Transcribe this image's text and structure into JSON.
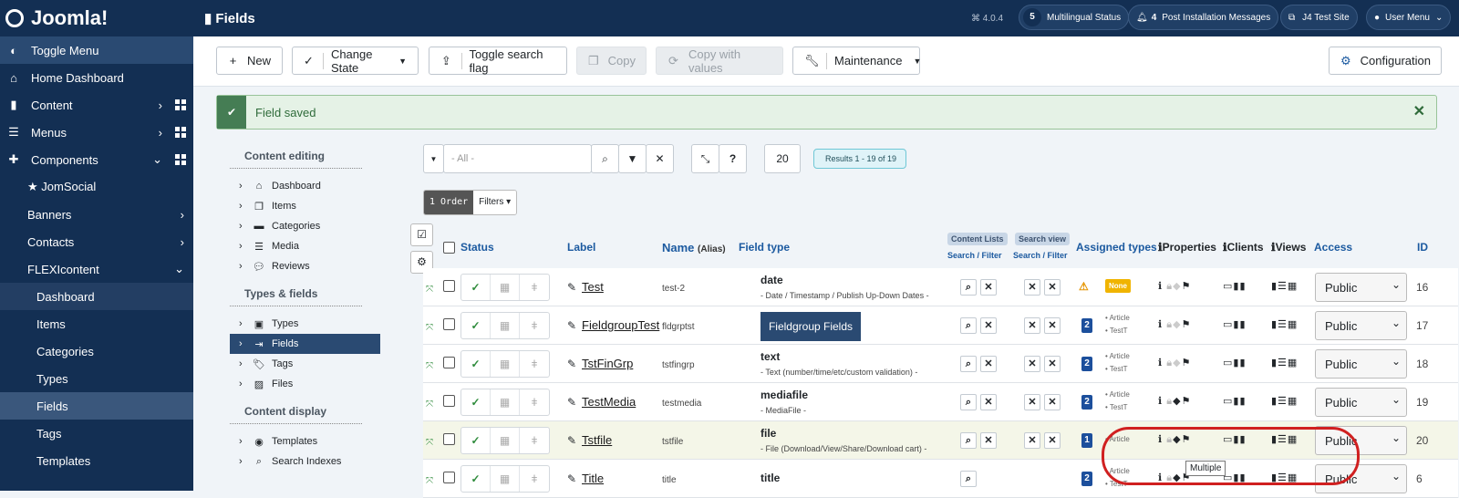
{
  "app": {
    "logo": "Joomla!",
    "version": "4.0.4"
  },
  "header": {
    "title": "Fields",
    "multilingual_count": "5",
    "multilingual": "Multilingual Status",
    "post_count": "4",
    "post": "Post Installation Messages",
    "site": "J4 Test Site",
    "user": "User Menu"
  },
  "sidebar": {
    "items": [
      {
        "label": "Toggle Menu",
        "icon": "toggle-icon"
      },
      {
        "label": "Home Dashboard",
        "icon": "home-icon"
      },
      {
        "label": "Content",
        "icon": "file-icon"
      },
      {
        "label": "Menus",
        "icon": "list-icon"
      },
      {
        "label": "Components",
        "icon": "puzzle-icon"
      },
      {
        "label": "★ JomSocial"
      },
      {
        "label": "Banners"
      },
      {
        "label": "Contacts"
      },
      {
        "label": "FLEXIcontent"
      },
      {
        "label": "Dashboard"
      },
      {
        "label": "Items"
      },
      {
        "label": "Categories"
      },
      {
        "label": "Types"
      },
      {
        "label": "Fields"
      },
      {
        "label": "Tags"
      },
      {
        "label": "Templates"
      }
    ]
  },
  "toolbar": {
    "new": "New",
    "change_state": "Change State",
    "toggle_search": "Toggle search flag",
    "copy": "Copy",
    "copy_values": "Copy with values",
    "maintenance": "Maintenance",
    "configuration": "Configuration"
  },
  "alert": {
    "message": "Field saved"
  },
  "leftmenu": {
    "section1": "Content editing",
    "s1": [
      "Dashboard",
      "Items",
      "Categories",
      "Media",
      "Reviews"
    ],
    "section2": "Types & fields",
    "s2": [
      "Types",
      "Fields",
      "Tags",
      "Files"
    ],
    "section3": "Content display",
    "s3": [
      "Templates",
      "Search Indexes"
    ]
  },
  "filters": {
    "select": "- All -",
    "limit": "20",
    "results": "Results 1 - 19 of 19",
    "order": "1 Order",
    "filters": "Filters"
  },
  "table": {
    "headers": {
      "status": "Status",
      "label": "Label",
      "name": "Name",
      "alias": "(Alias)",
      "field_type": "Field type",
      "content_lists": "Content Lists",
      "search_view": "Search view",
      "search_filter": "Search / Filter",
      "assigned": "Assigned types",
      "properties": "Properties",
      "clients": "Clients",
      "views": "Views",
      "access": "Access",
      "id": "ID"
    },
    "rows": [
      {
        "label": "Test",
        "name": "test-2",
        "type": "date",
        "desc": "- Date / Timestamp / Publish Up-Down Dates -",
        "assigned": "None",
        "types": [],
        "access": "Public",
        "id": "16"
      },
      {
        "label": "FieldgroupTest",
        "name": "fldgrptst",
        "type": "Fieldgroup Fields",
        "desc": "",
        "assigned": "2",
        "types": [
          "Article",
          "TestT"
        ],
        "access": "Public",
        "id": "17"
      },
      {
        "label": "TstFinGrp",
        "name": "tstfingrp",
        "type": "text",
        "desc": "- Text (number/time/etc/custom validation) -",
        "assigned": "2",
        "types": [
          "Article",
          "TestT"
        ],
        "access": "Public",
        "id": "18"
      },
      {
        "label": "TestMedia",
        "name": "testmedia",
        "type": "mediafile",
        "desc": "- MediaFile -",
        "assigned": "2",
        "types": [
          "Article",
          "TestT"
        ],
        "access": "Public",
        "id": "19"
      },
      {
        "label": "Tstfile",
        "name": "tstfile",
        "type": "file",
        "desc": "- File (Download/View/Share/Download cart) -",
        "assigned": "1",
        "types": [
          "Article"
        ],
        "access": "Public",
        "id": "20"
      },
      {
        "label": "Title",
        "name": "title",
        "type": "title",
        "desc": "",
        "assigned": "2",
        "types": [
          "Article",
          "TestT"
        ],
        "access": "Public",
        "id": "6"
      }
    ]
  },
  "tooltip": "Multiple"
}
